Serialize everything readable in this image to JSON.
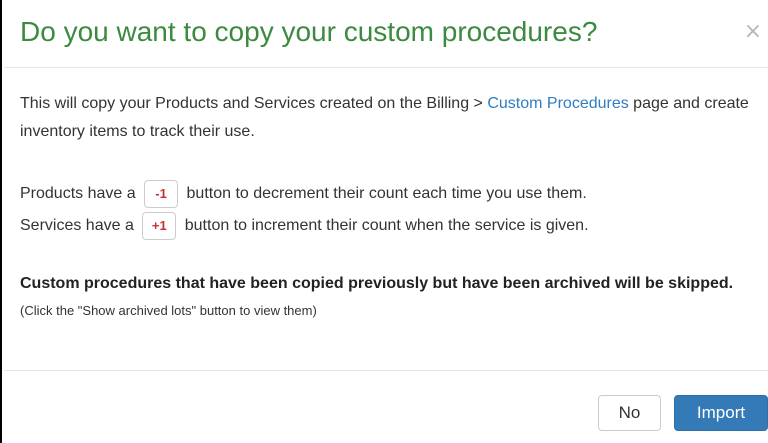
{
  "dialog": {
    "title": "Do you want to copy your custom procedures?",
    "close_symbol": "×",
    "body": {
      "intro_before_link": "This will copy your Products and Services created on the Billing > ",
      "intro_link": "Custom Procedures",
      "intro_after_link": " page and create inventory items to track their use.",
      "products_prefix": "Products have a",
      "products_button": "-1",
      "products_suffix": "button to decrement their count each time you use them.",
      "services_prefix": "Services have a",
      "services_button": "+1",
      "services_suffix": "button to increment their count when the service is given.",
      "notice_bold": "Custom procedures that have been copied previously but have been archived will be skipped.",
      "notice_small": "(Click the \"Show archived lots\" button to view them)"
    },
    "footer": {
      "no_label": "No",
      "import_label": "Import"
    }
  },
  "colors": {
    "title": "#3c8a3f",
    "link": "#2f7cc1",
    "counter_text": "#c9302c",
    "primary_button": "#337ab7"
  },
  "icons": {
    "close": "close-icon"
  }
}
